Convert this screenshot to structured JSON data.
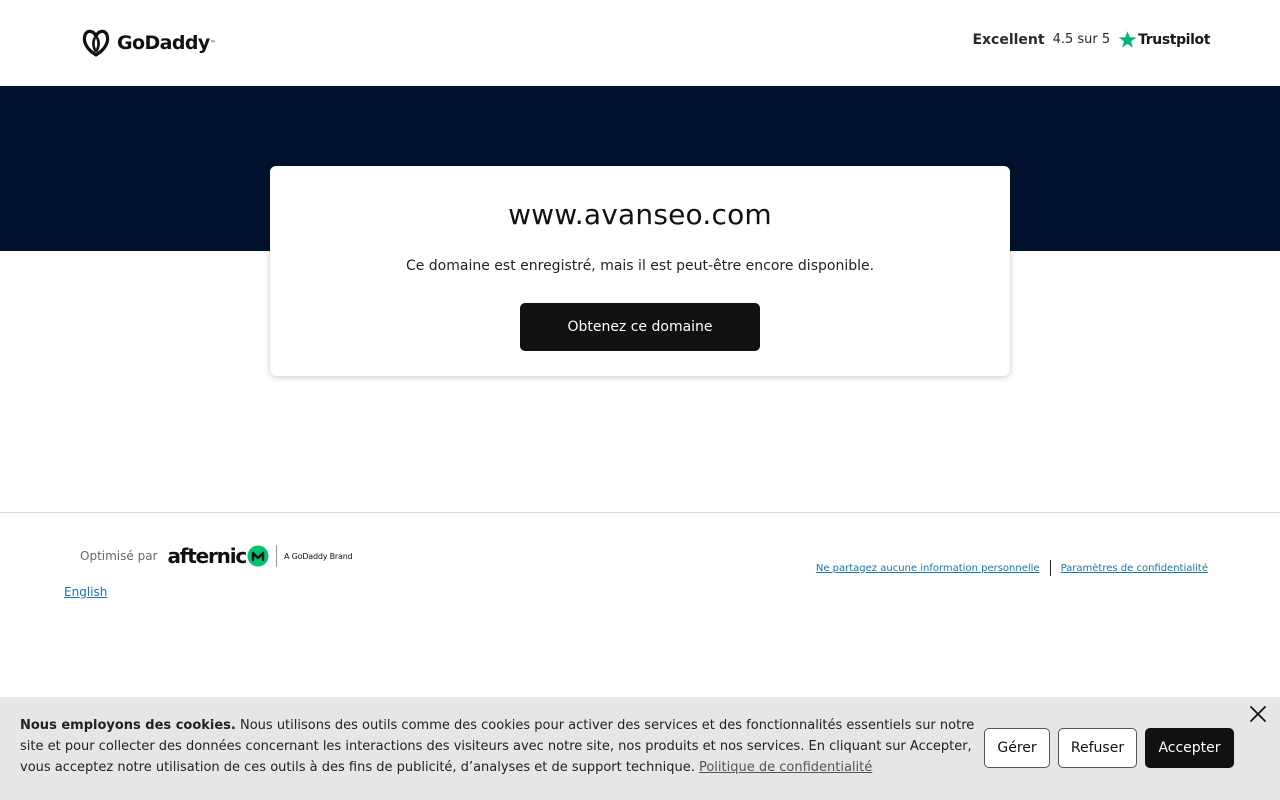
{
  "header": {
    "logo_text": "GoDaddy",
    "rating_word": "Excellent",
    "rating_score": "4.5 sur 5",
    "trustpilot_label": "Trustpilot"
  },
  "card": {
    "domain": "www.avanseo.com",
    "description": "Ce domaine est enregistré, mais il est peut-être encore disponible.",
    "button_label": "Obtenez ce domaine"
  },
  "footer": {
    "powered_label": "Optimisé par",
    "afternic_label": "afternic",
    "afternic_brand": "A GoDaddy Brand",
    "language_link": "English",
    "links": [
      "Ne partagez aucune information personnelle",
      "Paramètres de confidentialité"
    ]
  },
  "cookie": {
    "title": "Nous employons des cookies.",
    "body": " Nous utilisons des outils comme des cookies pour activer des services et des fonctionnalités essentiels sur notre site et pour collecter des données concernant les interactions des visiteurs avec notre site, nos produits et nos services. En cliquant sur Accepter, vous acceptez notre utilisation de ces outils à des fins de publicité, d’analyses et de support technique. ",
    "policy_link": "Politique de confidentialité",
    "manage_label": "Gérer",
    "refuse_label": "Refuser",
    "accept_label": "Accepter"
  },
  "colors": {
    "hero_background": "#00122e",
    "primary_button": "#111111",
    "link": "#1976a8",
    "trustpilot_green": "#00b67a",
    "afternic_green": "#00c26f",
    "cookie_background": "#e6e6e6"
  },
  "icons": {
    "logo": "godaddy-logo-icon",
    "trustpilot": "star-icon",
    "afternic": "afternic-logo-icon",
    "close": "close-icon"
  }
}
